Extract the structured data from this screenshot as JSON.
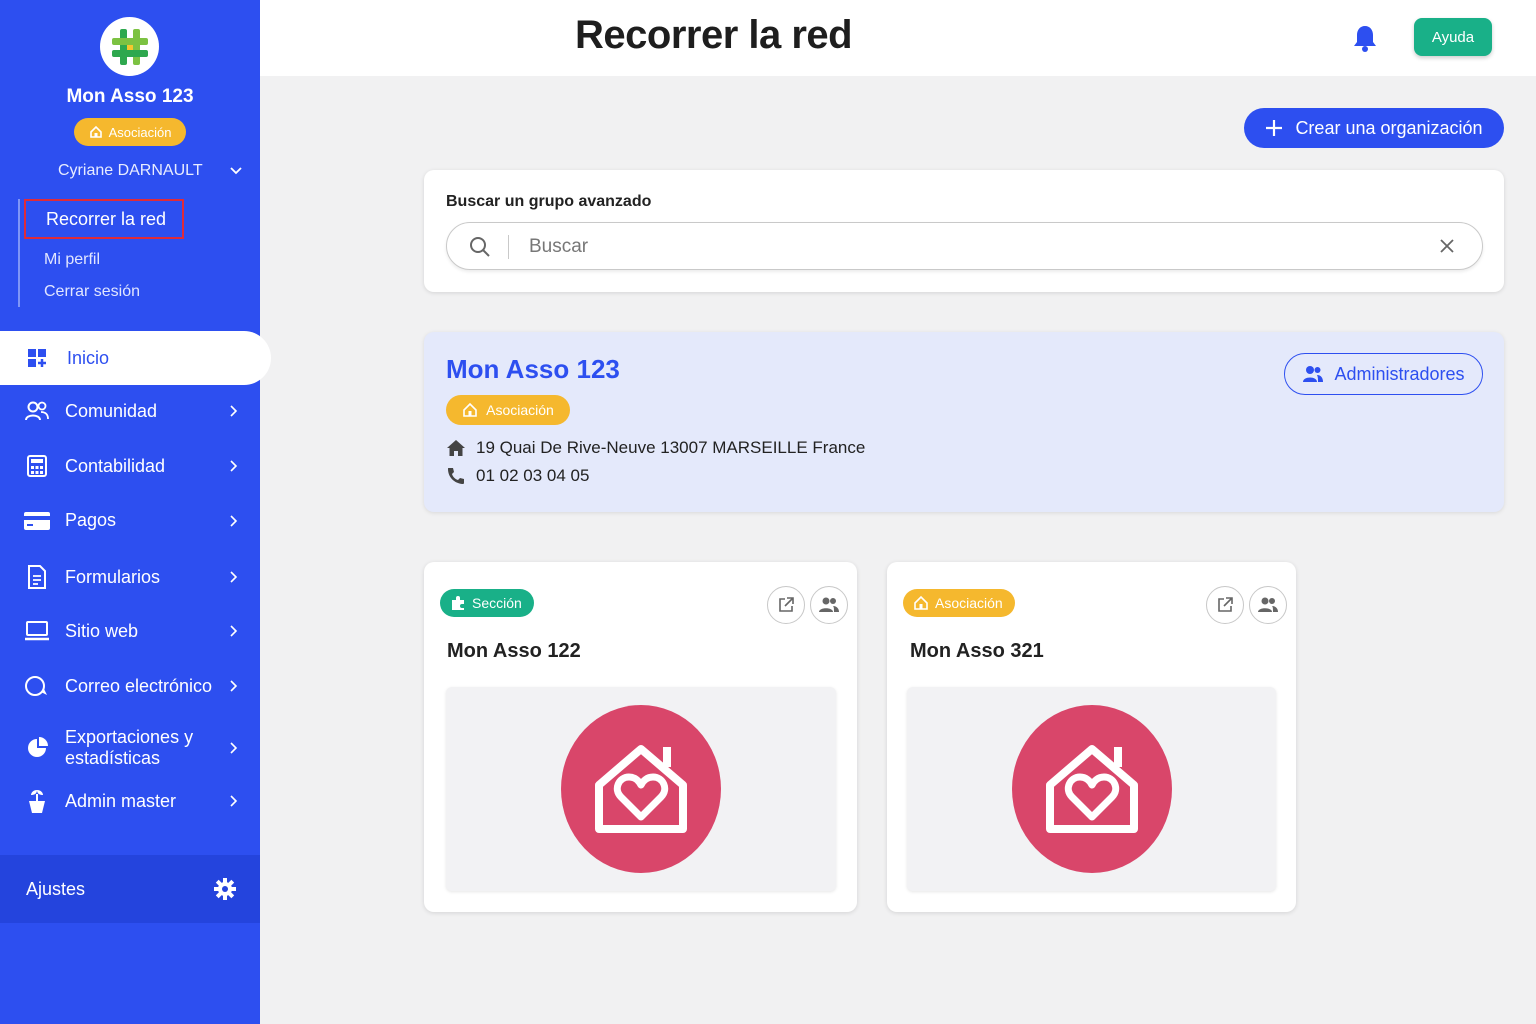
{
  "sidebar": {
    "org_name": "Mon Asso 123",
    "org_badge": "Asociación",
    "user_name": "Cyriane DARNAULT",
    "sub_nav": [
      {
        "label": "Recorrer la red",
        "active": true
      },
      {
        "label": "Mi perfil"
      },
      {
        "label": "Cerrar sesión"
      }
    ],
    "home": {
      "label": "Inicio",
      "icon": "dashboard-icon"
    },
    "items": [
      {
        "label": "Comunidad",
        "icon": "community-icon"
      },
      {
        "label": "Contabilidad",
        "icon": "calculator-icon"
      },
      {
        "label": "Pagos",
        "icon": "credit-card-icon"
      },
      {
        "label": "Formularios",
        "icon": "form-icon"
      },
      {
        "label": "Sitio web",
        "icon": "laptop-icon"
      },
      {
        "label": "Correo electrónico",
        "icon": "chat-icon"
      },
      {
        "label": "Exportaciones y estadísticas",
        "icon": "pie-chart-icon"
      },
      {
        "label": "Admin master",
        "icon": "plant-icon"
      }
    ],
    "settings_label": "Ajustes"
  },
  "header": {
    "title": "Recorrer la red",
    "help_label": "Ayuda"
  },
  "main": {
    "create_label": "Crear una organización",
    "search": {
      "label": "Buscar un grupo avanzado",
      "placeholder": "Buscar",
      "value": ""
    },
    "current_org": {
      "name": "Mon Asso 123",
      "badge": "Asociación",
      "address": "19 Quai De Rive-Neuve 13007 MARSEILLE France",
      "phone": "01 02 03 04 05",
      "admins_label": "Administradores"
    },
    "cards": [
      {
        "badge": "Sección",
        "badge_color": "#19b088",
        "name": "Mon Asso 122"
      },
      {
        "badge": "Asociación",
        "badge_color": "#f5b82e",
        "name": "Mon Asso 321"
      }
    ]
  },
  "colors": {
    "primary": "#2d4ff0",
    "success": "#19b088",
    "warning": "#f5b82e",
    "accent_pink": "#d9466a",
    "highlight_red": "#e02b3a"
  }
}
